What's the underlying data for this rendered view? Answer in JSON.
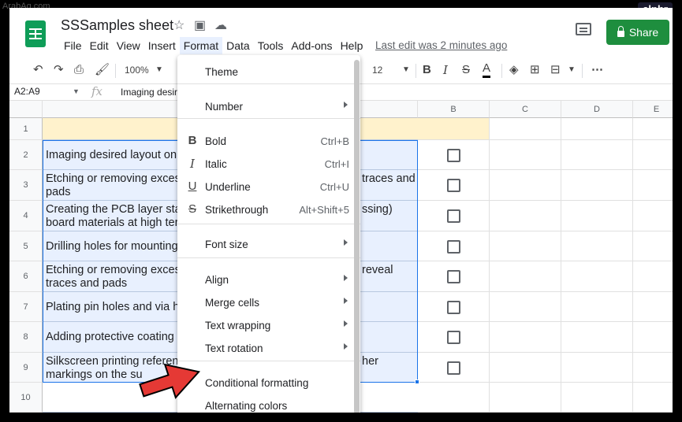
{
  "watermarks": {
    "left": "ArabAq.com",
    "right": "alphr"
  },
  "header": {
    "title": "SSSamples sheet",
    "last_edit": "Last edit was 2 minutes ago",
    "share_label": "Share"
  },
  "menubar": [
    "File",
    "Edit",
    "View",
    "Insert",
    "Format",
    "Data",
    "Tools",
    "Add-ons",
    "Help"
  ],
  "toolbar": {
    "zoom": "100%",
    "font_size": "12"
  },
  "formula_bar": {
    "name_box": "A2:A9",
    "fx": "fx",
    "content": "Imaging desire"
  },
  "columns": {
    "b": "B",
    "c": "C",
    "d": "D",
    "e": "E"
  },
  "rows": [
    {
      "num": "1",
      "text": ""
    },
    {
      "num": "2",
      "text": "Imaging desired layout on"
    },
    {
      "num": "3",
      "text": "Etching or removing exces",
      "right": "traces and",
      "line2": "pads"
    },
    {
      "num": "4",
      "text": "Creating the PCB layer sta",
      "right": "ssing)",
      "line2": "board materials at high ter"
    },
    {
      "num": "5",
      "text": "Drilling holes for mounting"
    },
    {
      "num": "6",
      "text": "Etching or removing exces",
      "right": "reveal",
      "line2": "traces and pads"
    },
    {
      "num": "7",
      "text": "Plating pin holes and via h"
    },
    {
      "num": "8",
      "text": "Adding protective coating t"
    },
    {
      "num": "9",
      "text": "Silkscreen printing referen",
      "right": "her",
      "line2": "markings on the su"
    },
    {
      "num": "10",
      "text": ""
    }
  ],
  "format_menu": {
    "theme": "Theme",
    "number": "Number",
    "bold": {
      "label": "Bold",
      "shortcut": "Ctrl+B"
    },
    "italic": {
      "label": "Italic",
      "shortcut": "Ctrl+I"
    },
    "underline": {
      "label": "Underline",
      "shortcut": "Ctrl+U"
    },
    "strikethrough": {
      "label": "Strikethrough",
      "shortcut": "Alt+Shift+5"
    },
    "font_size": "Font size",
    "align": "Align",
    "merge": "Merge cells",
    "wrapping": "Text wrapping",
    "rotation": "Text rotation",
    "conditional": "Conditional formatting",
    "alternating": "Alternating colors"
  },
  "colors": {
    "accent_green": "#1e8e3e",
    "selection": "#e8f0fe",
    "header_fill": "#fff2cc",
    "arrow_red": "#e53935"
  }
}
